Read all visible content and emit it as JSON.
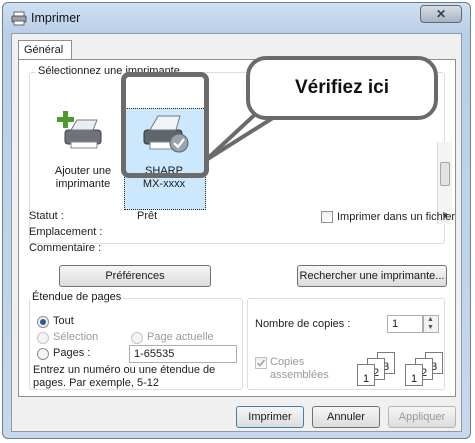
{
  "window": {
    "title": "Imprimer",
    "close_glyph": "✕"
  },
  "tab": {
    "label": "Général"
  },
  "printer_group": {
    "label": "Sélectionnez une imprimante",
    "printers": [
      {
        "name": "Ajouter une imprimante",
        "line1": "Ajouter une",
        "line2": "imprimante",
        "icon": "add-printer-icon"
      },
      {
        "name": "SHARP MX-xxxx",
        "line1": "SHARP",
        "line2": "MX-xxxx",
        "icon": "printer-icon",
        "selected": true
      }
    ]
  },
  "callout": {
    "text": "Vérifiez ici"
  },
  "status": {
    "status_label": "Statut :",
    "status_value": "Prêt",
    "location_label": "Emplacement :",
    "comment_label": "Commentaire :",
    "print_to_file_label": "Imprimer dans un fichier"
  },
  "buttons": {
    "preferences": "Préférences",
    "find_printer": "Rechercher une imprimante...",
    "print": "Imprimer",
    "cancel": "Annuler",
    "apply": "Appliquer"
  },
  "page_range": {
    "label": "Étendue de pages",
    "all": "Tout",
    "selection": "Sélection",
    "current_page": "Page actuelle",
    "pages": "Pages :",
    "pages_value": "1-65535",
    "help_line1": "Entrez un numéro ou une étendue de",
    "help_line2": "pages. Par exemple, 5-12"
  },
  "copies": {
    "label": "Nombre de copies :",
    "value": "1",
    "collate_line1": "Copies",
    "collate_line2": "assemblées",
    "collate_checked": true,
    "collate_page_numbers": [
      "1",
      "2",
      "3"
    ]
  },
  "colors": {
    "accent": "#2b5a8f",
    "highlight_frame": "#6b6b6b",
    "selection": "#cce8ff"
  }
}
